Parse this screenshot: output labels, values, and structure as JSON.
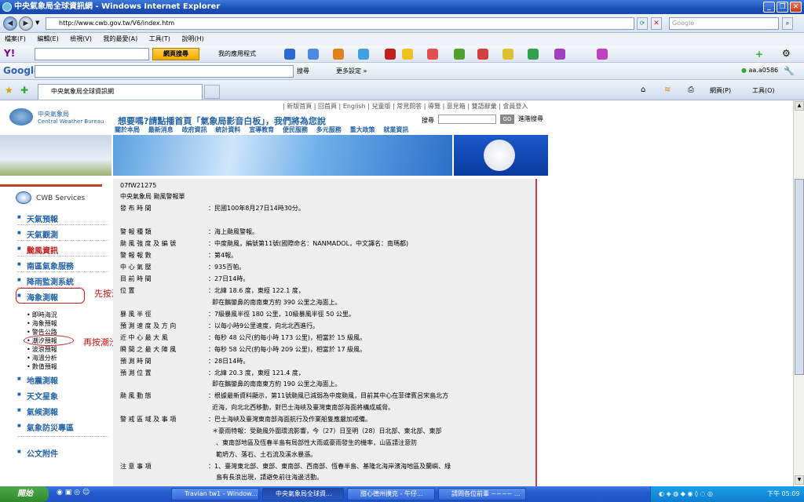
{
  "window": {
    "title": "中央氣象局全球資訊網 - Windows Internet Explorer"
  },
  "address": {
    "url": "http://www.cwb.gov.tw/V6/index.htm",
    "search_placeholder": "Google"
  },
  "menu": [
    "檔案(F)",
    "編輯(E)",
    "檢視(V)",
    "我的最愛(A)",
    "工具(T)",
    "說明(H)"
  ],
  "yahoo": {
    "search_btn": "網頁搜尋",
    "apps": "我的應用程式"
  },
  "google": {
    "label": "Google",
    "search": "搜尋",
    "more": "更多設定 »",
    "user": "aa.a0586"
  },
  "tab": {
    "title": "中央氣象局全球資訊網"
  },
  "ietools": {
    "page": "網頁(P)",
    "tools": "工具(O)"
  },
  "cwb": {
    "logo_cn": "中央氣象局",
    "logo_en": "Central Weather Bureau",
    "toplinks": "| 新版首頁 | 回首頁 | English | 兒童版 | 常見問答 | 導覽 | 意見箱 | 雙語辭彙 | 會員登入",
    "banner": "想要嗎?請點播首頁「氣象局影音白板」，我們將為您說",
    "search_label": "搜尋",
    "go": "GO",
    "advanced": "進階搜尋",
    "mainnav": [
      "關於本局",
      "最新消息",
      "政府資訊",
      "統計資料",
      "宣導教育",
      "便民服務",
      "多元服務",
      "重大政策",
      "就業資訊"
    ],
    "services_title": "CWB Services",
    "sidenav": [
      "天氣預報",
      "天氣觀測",
      "颱風資訊",
      "南區氣象服務",
      "降雨監測系統",
      "海象測報",
      "地震測報",
      "天文星象",
      "氣候測報",
      "氣象防災專區",
      "公文附件"
    ],
    "subnav": [
      "即時海況",
      "海象預報",
      "警告公路",
      "潮汐預報",
      "波浪預報",
      "海溫分析",
      "數值預報"
    ]
  },
  "doc": {
    "code": "07fW21275",
    "org": "中央氣象局    颱風警報單",
    "rows": [
      {
        "k": "發    布    時    間",
        "v": "民國100年8月27日14時30分。"
      },
      {
        "k": "警    報    種    類",
        "v": "海上颱風警報。"
      },
      {
        "k": "颱 風 強 度 及 編 號",
        "v": "中度颱風，編號第11號(國際命名：NANMADOL，中文譯名：南瑪都)"
      },
      {
        "k": "警    報    報    數",
        "v": "第4報。"
      },
      {
        "k": "中    心    氣    壓",
        "v": "935百帕。"
      },
      {
        "k": "目    前    時    間",
        "v": "27日14時。"
      },
      {
        "k": "位                置",
        "v": "北緯 18.6 度，東經 122.1 度，"
      },
      {
        "k": "",
        "v": "即在鵝鑾鼻的南南東方約 390 公里之海面上。"
      },
      {
        "k": "暴    風    半    徑",
        "v": "7級暴風半徑 180 公里，10級暴風半徑 50 公里。"
      },
      {
        "k": "預 測 速 度 及 方 向",
        "v": "以每小時9公里速度，向北北西進行。"
      },
      {
        "k": "近  中  心  最  大  風",
        "v": "每秒 48 公尺(約每小時 173 公里)，相當於 15 級風。"
      },
      {
        "k": "瞬  間  之  最  大  陣  風",
        "v": "每秒 58 公尺(約每小時 209 公里)，相當於 17 級風。"
      },
      {
        "k": "預    測    時    間",
        "v": "28日14時。"
      },
      {
        "k": "預    測    位    置",
        "v": "北緯 20.3 度，東經 121.4 度，"
      },
      {
        "k": "",
        "v": "即在鵝鑾鼻的南南東方約 190 公里之海面上。"
      },
      {
        "k": "颱    風    動    態",
        "v": "根據最新資料顯示，第11號颱風已減弱為中度颱風，目前其中心在菲律賓呂宋島北方"
      },
      {
        "k": "",
        "v": "近海，向北北西移動，對巴士海峽及臺灣東南部海面將構成威脅。"
      },
      {
        "k": "警 戒 區 域 及 事 項",
        "v": "巴士海峽及臺灣東南部海面航行及作業船隻應嚴加戒備。"
      },
      {
        "k": "",
        "v": "＊豪雨特報：受颱風外圍環流影響，今（27）日至明（28）日北部、東北部、東部"
      },
      {
        "k": "",
        "v": "、東南部地區及恆春半島有局部性大雨或豪雨發生的機率，山區請注意防"
      },
      {
        "k": "",
        "v": "範坍方、落石、土石流及溪水暴漲。"
      },
      {
        "k": "注    意    事    項",
        "v": "1、臺灣東北部、東部、東南部、西南部、恆春半島、基隆北海岸濱海地區及蘭嶼、綠"
      },
      {
        "k": "",
        "v": "島有長浪出現，請避免前往海邊活動。"
      }
    ]
  },
  "annotations": {
    "first": "先按海象預測",
    "second": "再按潮汐預報"
  },
  "taskbar": {
    "start": "開始",
    "tasks": [
      "Travian tw1 - Window...",
      "中央氣象局全球資...",
      "甜心德州撲克 - 午仔...",
      "請問各位前輩 ~~~~ ..."
    ],
    "clock": "下午 05:09"
  }
}
